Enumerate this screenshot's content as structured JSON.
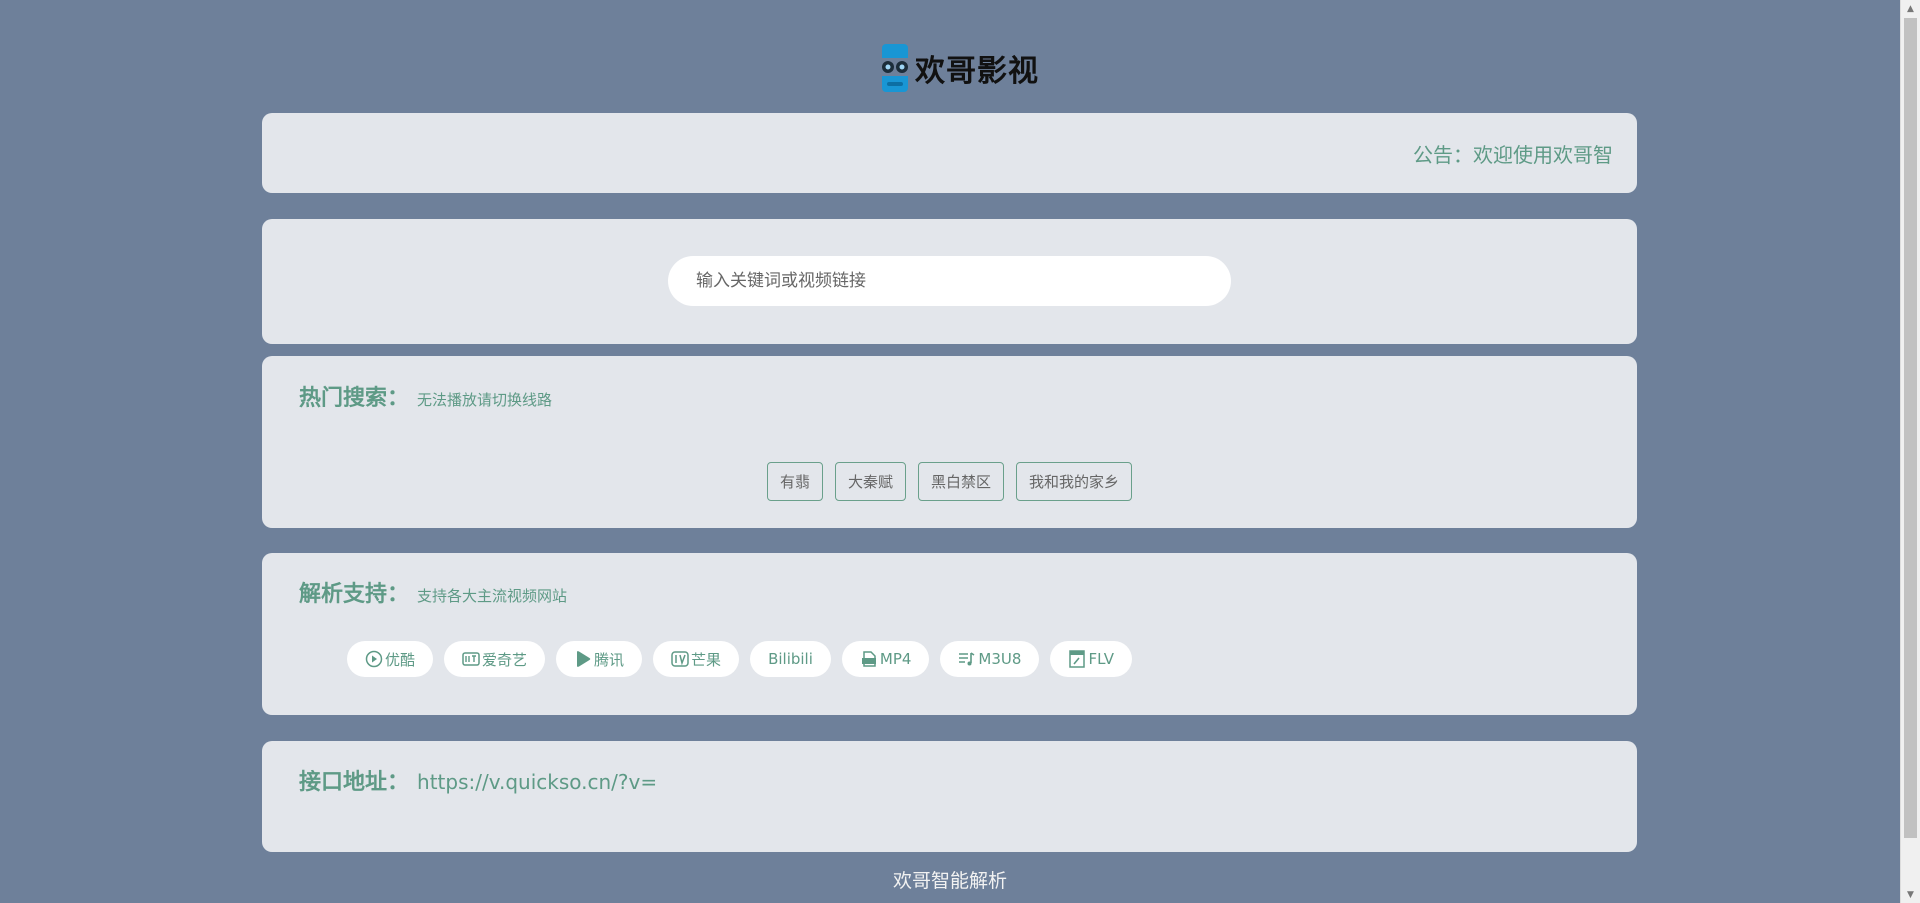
{
  "logo": {
    "text": "欢哥影视"
  },
  "notice": {
    "text": "公告：欢迎使用欢哥智"
  },
  "search": {
    "placeholder": "输入关键词或视频链接"
  },
  "hot": {
    "title": "热门搜索：",
    "subtitle": "无法播放请切换线路",
    "tags": [
      "有翡",
      "大秦赋",
      "黑白禁区",
      "我和我的家乡"
    ]
  },
  "parse": {
    "title": "解析支持：",
    "subtitle": "支持各大主流视频网站",
    "platforms": [
      {
        "label": "优酷",
        "icon": "youku-icon"
      },
      {
        "label": "爱奇艺",
        "icon": "iqiyi-icon"
      },
      {
        "label": "腾讯",
        "icon": "tencent-play-icon"
      },
      {
        "label": "芒果",
        "icon": "mango-icon"
      },
      {
        "label": "Bilibili",
        "icon": ""
      },
      {
        "label": "MP4",
        "icon": "mp4-icon"
      },
      {
        "label": "M3U8",
        "icon": "playlist-icon"
      },
      {
        "label": "FLV",
        "icon": "flv-file-icon"
      }
    ]
  },
  "api": {
    "title": "接口地址：",
    "url": "https://v.quickso.cn/?v="
  },
  "footer": {
    "text": "欢哥智能解析"
  },
  "colors": {
    "background": "#6e809a",
    "card": "#e3e6eb",
    "accent": "#5e9a86"
  }
}
